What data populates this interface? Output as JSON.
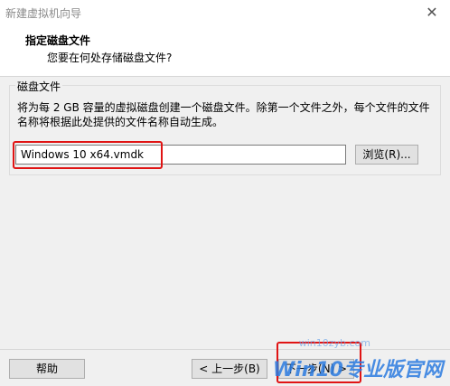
{
  "window": {
    "title": "新建虚拟机向导",
    "close_glyph": "✕"
  },
  "header": {
    "heading": "指定磁盘文件",
    "subheading": "您要在何处存储磁盘文件?"
  },
  "group": {
    "legend": "磁盘文件",
    "description": "将为每 2 GB 容量的虚拟磁盘创建一个磁盘文件。除第一个文件之外，每个文件的文件名称将根据此处提供的文件名称自动生成。"
  },
  "file_input": {
    "value": "Windows 10 x64.vmdk"
  },
  "buttons": {
    "browse": "浏览(R)...",
    "help": "帮助",
    "back": "< 上一步(B)",
    "next": "下一步(N) >"
  },
  "watermark": {
    "text": "Win10专业版官网",
    "url": "win10zyb.com"
  },
  "colors": {
    "highlight": "#e01414",
    "button_face": "#e1e1e1",
    "window_bg": "#f0f0f0"
  }
}
